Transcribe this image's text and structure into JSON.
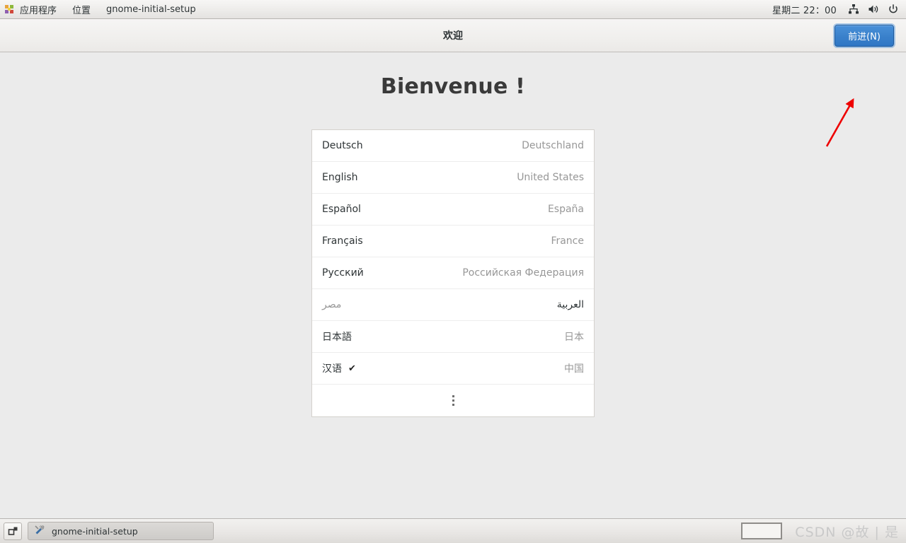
{
  "top_panel": {
    "apps_icon": "applications-grid-icon",
    "menus": [
      {
        "label": "应用程序"
      },
      {
        "label": "位置"
      },
      {
        "label": "gnome-initial-setup"
      }
    ],
    "clock": "星期二 22：00",
    "tray": [
      {
        "icon": "network-wired-icon"
      },
      {
        "icon": "volume-speaker-icon"
      },
      {
        "icon": "power-icon"
      }
    ]
  },
  "headerbar": {
    "title": "欢迎",
    "forward_label": "前进(N)",
    "accent_color": "#3b82cc"
  },
  "content": {
    "welcome_title": "Bienvenue !",
    "languages": [
      {
        "name": "Deutsch",
        "region": "Deutschland",
        "selected": false,
        "rtl": false
      },
      {
        "name": "English",
        "region": "United States",
        "selected": false,
        "rtl": false
      },
      {
        "name": "Español",
        "region": "España",
        "selected": false,
        "rtl": false
      },
      {
        "name": "Français",
        "region": "France",
        "selected": false,
        "rtl": false
      },
      {
        "name": "Русский",
        "region": "Российская Федерация",
        "selected": false,
        "rtl": false
      },
      {
        "name": "العربية",
        "region": "مصر",
        "selected": false,
        "rtl": true
      },
      {
        "name": "日本語",
        "region": "日本",
        "selected": false,
        "rtl": false
      },
      {
        "name": "汉语",
        "region": "中国",
        "selected": true,
        "rtl": false
      }
    ],
    "more_icon": "more-vertical-icon",
    "check_glyph": "✔"
  },
  "annotation": {
    "arrow_color": "#ee0000"
  },
  "taskbar": {
    "show_desktop_icon": "show-desktop-icon",
    "window_icon": "tools-icon",
    "window_label": "gnome-initial-setup",
    "watermark": "CSDN @故 | 是"
  }
}
